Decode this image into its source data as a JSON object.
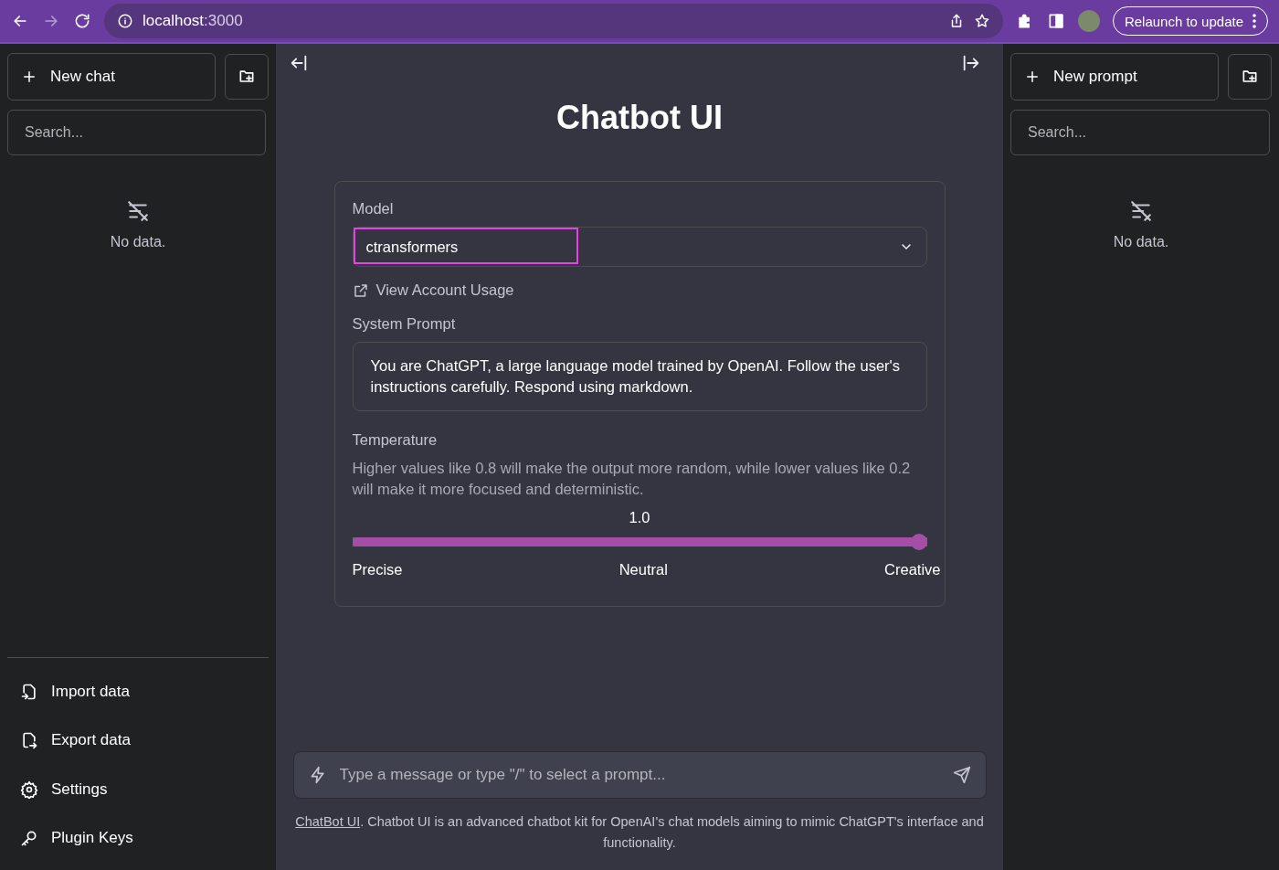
{
  "browser": {
    "url_host": "localhost",
    "url_port": ":3000",
    "relaunch_button": "Relaunch to update"
  },
  "left_sidebar": {
    "new_button": "New chat",
    "search": {
      "placeholder": "Search..."
    },
    "empty_text": "No data.",
    "footer_items": [
      {
        "kind": "import",
        "label": "Import data"
      },
      {
        "kind": "export",
        "label": "Export data"
      },
      {
        "kind": "settings",
        "label": "Settings"
      },
      {
        "kind": "key",
        "label": "Plugin Keys"
      }
    ]
  },
  "main": {
    "title": "Chatbot UI",
    "model_label": "Model",
    "model_value": "ctransformers",
    "model_highlighted": true,
    "usage_link": "View Account Usage",
    "system_prompt_label": "System Prompt",
    "system_prompt": "You are ChatGPT, a large language model trained by OpenAI. Follow the user's instructions carefully. Respond using markdown.",
    "temperature_label": "Temperature",
    "temperature_help": "Higher values like 0.8 will make the output more random, while lower values like 0.2 will make it more focused and deterministic.",
    "temperature_reading": "1.0",
    "temperature": {
      "level": 1
    },
    "scale_labels": [
      "Precise",
      "Neutral",
      "Creative"
    ],
    "message": {
      "placeholder": "Type a message or type \"/\" to select a prompt..."
    },
    "footer_link": "ChatBot UI",
    "footer_text": ". Chatbot UI is an advanced chatbot kit for OpenAI's chat models aiming to mimic ChatGPT's interface and functionality."
  },
  "right_sidebar": {
    "new_button": "New prompt",
    "search": {
      "placeholder": "Search..."
    },
    "empty_text": "No data."
  }
}
